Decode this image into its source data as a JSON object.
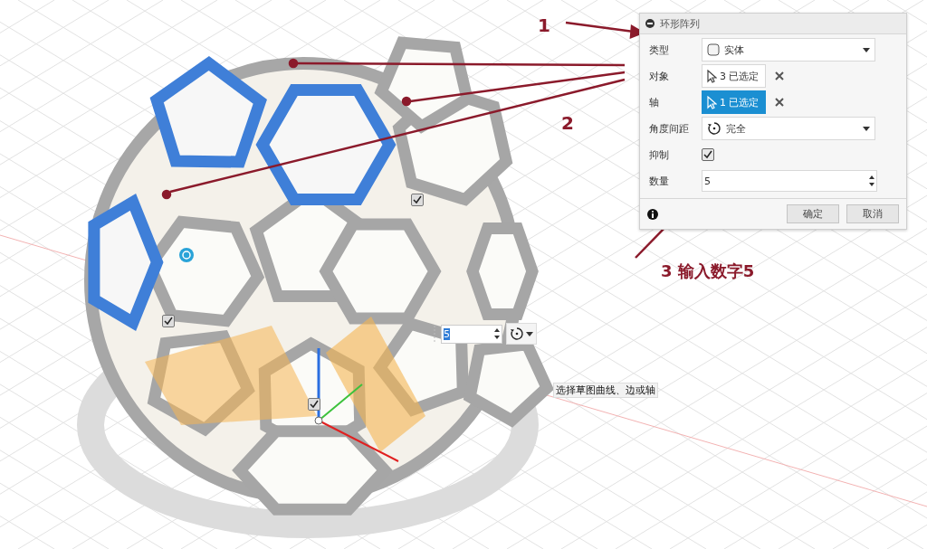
{
  "dialog": {
    "title": "环形阵列",
    "rows": [
      {
        "kind": "dropdown",
        "label": "类型",
        "value": "实体"
      },
      {
        "kind": "selection",
        "label": "对象",
        "value": "3 已选定",
        "selected": false
      },
      {
        "kind": "selection",
        "label": "轴",
        "value": "1 已选定",
        "selected": true
      },
      {
        "kind": "dropdown",
        "label": "角度间距",
        "value": "完全"
      },
      {
        "kind": "checkbox",
        "label": "抑制",
        "checked": true
      },
      {
        "kind": "number",
        "label": "数量",
        "value": "5"
      }
    ],
    "buttons": [
      {
        "label": "确定"
      },
      {
        "label": "取消"
      }
    ]
  },
  "viewport": {
    "inline_field": {
      "value": "5"
    },
    "tooltip": "选择草图曲线、边或轴",
    "checkboxes": [
      {
        "checked": true
      },
      {
        "checked": true
      },
      {
        "checked": true
      }
    ]
  },
  "annotations": [
    {
      "label": "1"
    },
    {
      "label": "2"
    },
    {
      "label": "3 输入数字5"
    }
  ]
}
